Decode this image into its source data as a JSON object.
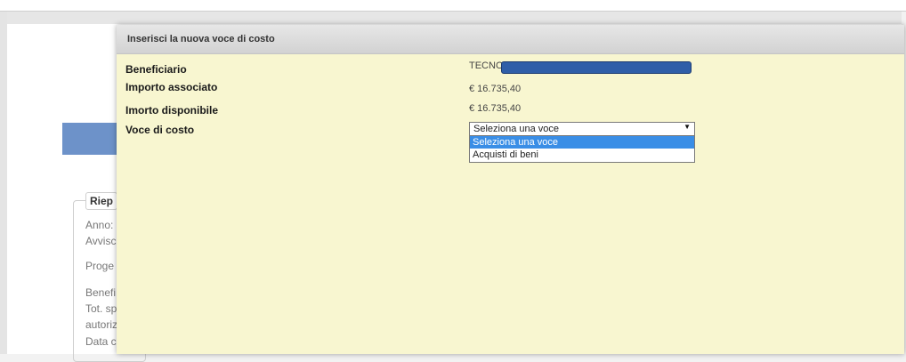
{
  "background": {
    "legend": "Riep",
    "lines": [
      "Anno:",
      "Avvisc",
      "Proge",
      "Benefi",
      "Tot. sp",
      "autoriz",
      "Data c"
    ]
  },
  "modal": {
    "title": "Inserisci la nuova voce di costo",
    "fields": [
      {
        "label": "Beneficiario",
        "value": "TECNO"
      },
      {
        "label": "Importo associato",
        "value": "€ 16.735,40"
      },
      {
        "label": "Imorto disponibile",
        "value": "€ 16.735,40"
      },
      {
        "label": "Voce di costo"
      }
    ],
    "select": {
      "value": "Seleziona una voce",
      "options": [
        "Seleziona una voce",
        "Acquisti di beni"
      ]
    }
  }
}
